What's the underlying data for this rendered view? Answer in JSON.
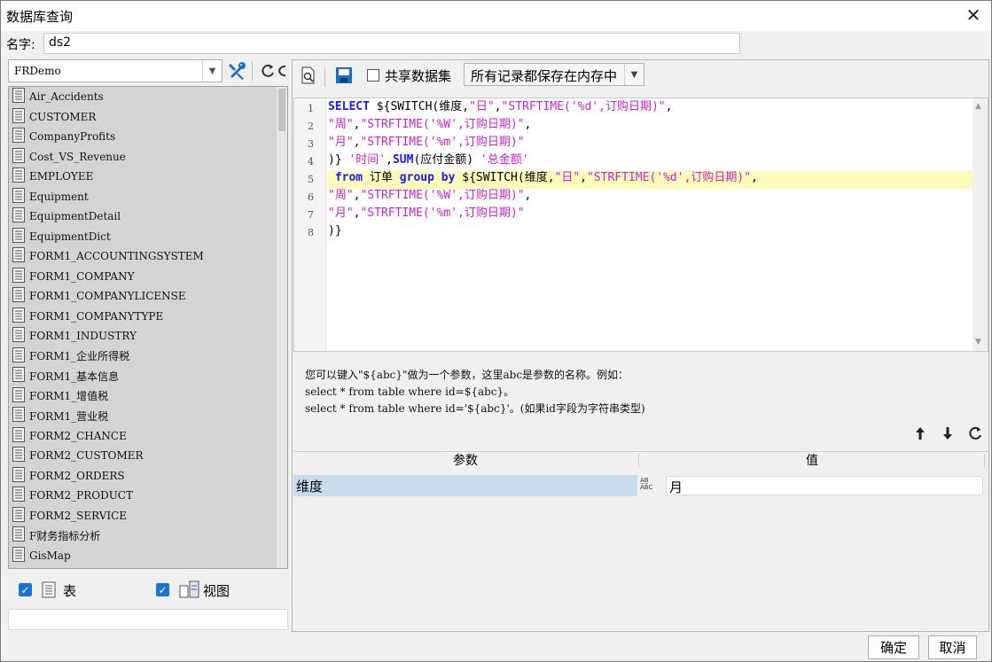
{
  "window": {
    "title": "数据库查询"
  },
  "name_field": {
    "label": "名字:",
    "value": "ds2"
  },
  "left": {
    "db_select": "FRDemo",
    "tables": [
      "Air_Accidents",
      "CUSTOMER",
      "CompanyProfits",
      "Cost_VS_Revenue",
      "EMPLOYEE",
      "Equipment",
      "EquipmentDetail",
      "EquipmentDict",
      "FORM1_ACCOUNTINGSYSTEM",
      "FORM1_COMPANY",
      "FORM1_COMPANYLICENSE",
      "FORM1_COMPANYTYPE",
      "FORM1_INDUSTRY",
      "FORM1_企业所得税",
      "FORM1_基本信息",
      "FORM1_增值税",
      "FORM1_营业税",
      "FORM2_CHANCE",
      "FORM2_CUSTOMER",
      "FORM2_ORDERS",
      "FORM2_PRODUCT",
      "FORM2_SERVICE",
      "F财务指标分析",
      "GisMap"
    ],
    "filter_table_label": "表",
    "filter_view_label": "视图"
  },
  "right": {
    "share_label": "共享数据集",
    "mode_select": "所有记录都保存在内存中",
    "line_numbers": [
      "1",
      "2",
      "3",
      "4",
      "5",
      "6",
      "7",
      "8"
    ],
    "code": {
      "l1_kw": "SELECT",
      "l1_a": " ${SWITCH(维度,",
      "l1_s1": "\"日\"",
      "l1_b": ",",
      "l1_s2": "\"STRFTIME('%d',订购日期)\"",
      "l1_c": ",",
      "l2_s1": "\"周\"",
      "l2_a": ",",
      "l2_s2": "\"STRFTIME('%W',订购日期)\"",
      "l2_b": ",",
      "l3_s1": "\"月\"",
      "l3_a": ",",
      "l3_s2": "\"STRFTIME('%m',订购日期)\"",
      "l4_a": ")}",
      "l4_s1": " '时间'",
      "l4_b": ",",
      "l4_kw": "SUM",
      "l4_c": "(应付金额)",
      "l4_s2": " '总金额'",
      "l5_kw1": " from",
      "l5_a": " 订单 ",
      "l5_kw2": "group by",
      "l5_b": " ${SWITCH(维度,",
      "l5_s1": "\"日\"",
      "l5_c": ",",
      "l5_s2": "\"STRFTIME('%d',订购日期)\"",
      "l5_d": ",",
      "l6_s1": "\"周\"",
      "l6_a": ",",
      "l6_s2": "\"STRFTIME('%W',订购日期)\"",
      "l6_b": ",",
      "l7_s1": "\"月\"",
      "l7_a": ",",
      "l7_s2": "\"STRFTIME('%m',订购日期)\"",
      "l8_a": ")}"
    },
    "hint_lines": [
      "您可以键入\"${abc}\"做为一个参数，这里abc是参数的名称。例如：",
      "select * from table where id=${abc}。",
      "select * from table where id='${abc}'。(如果id字段为字符串类型)"
    ],
    "param_table": {
      "col_param": "参数",
      "col_value": "值",
      "rows": [
        {
          "name": "维度",
          "type_icon_top": "A̲B̲",
          "type_icon_bottom": "ABC",
          "value": "月"
        }
      ]
    }
  },
  "buttons": {
    "ok": "确定",
    "cancel": "取消"
  }
}
